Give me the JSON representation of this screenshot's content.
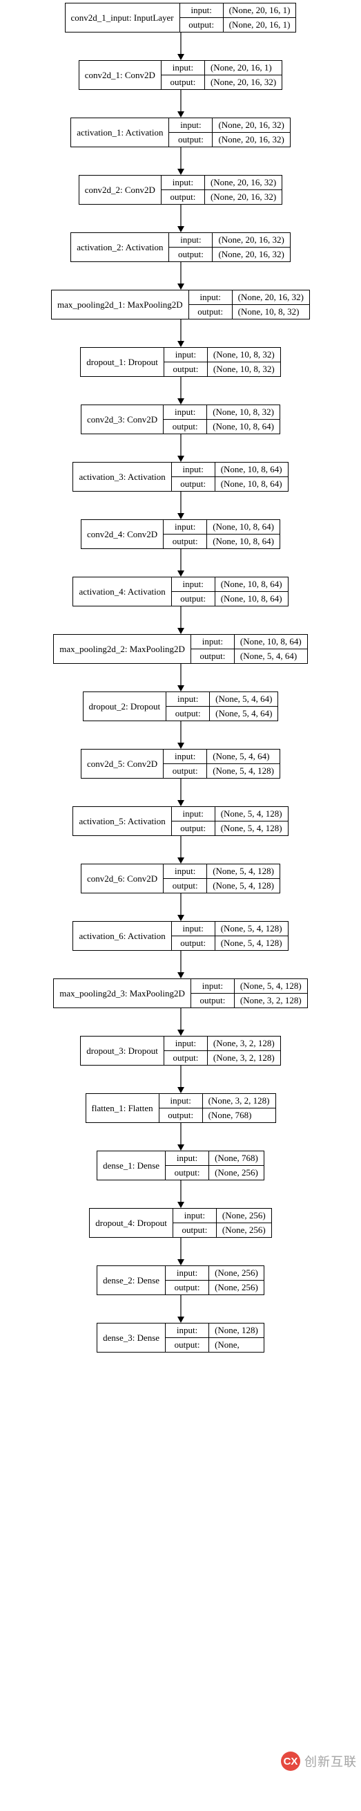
{
  "labels": {
    "input": "input:",
    "output": "output:"
  },
  "watermark": {
    "initials": "CX",
    "text": "创新互联"
  },
  "chart_data": {
    "type": "diagram",
    "title": "Keras Sequential CNN model graph",
    "nodes": [
      {
        "name": "conv2d_1_input: InputLayer",
        "in": "(None, 20, 16, 1)",
        "out": "(None, 20, 16, 1)"
      },
      {
        "name": "conv2d_1: Conv2D",
        "in": "(None, 20, 16, 1)",
        "out": "(None, 20, 16, 32)"
      },
      {
        "name": "activation_1: Activation",
        "in": "(None, 20, 16, 32)",
        "out": "(None, 20, 16, 32)"
      },
      {
        "name": "conv2d_2: Conv2D",
        "in": "(None, 20, 16, 32)",
        "out": "(None, 20, 16, 32)"
      },
      {
        "name": "activation_2: Activation",
        "in": "(None, 20, 16, 32)",
        "out": "(None, 20, 16, 32)"
      },
      {
        "name": "max_pooling2d_1: MaxPooling2D",
        "in": "(None, 20, 16, 32)",
        "out": "(None, 10, 8, 32)"
      },
      {
        "name": "dropout_1: Dropout",
        "in": "(None, 10, 8, 32)",
        "out": "(None, 10, 8, 32)"
      },
      {
        "name": "conv2d_3: Conv2D",
        "in": "(None, 10, 8, 32)",
        "out": "(None, 10, 8, 64)"
      },
      {
        "name": "activation_3: Activation",
        "in": "(None, 10, 8, 64)",
        "out": "(None, 10, 8, 64)"
      },
      {
        "name": "conv2d_4: Conv2D",
        "in": "(None, 10, 8, 64)",
        "out": "(None, 10, 8, 64)"
      },
      {
        "name": "activation_4: Activation",
        "in": "(None, 10, 8, 64)",
        "out": "(None, 10, 8, 64)"
      },
      {
        "name": "max_pooling2d_2: MaxPooling2D",
        "in": "(None, 10, 8, 64)",
        "out": "(None, 5, 4, 64)"
      },
      {
        "name": "dropout_2: Dropout",
        "in": "(None, 5, 4, 64)",
        "out": "(None, 5, 4, 64)"
      },
      {
        "name": "conv2d_5: Conv2D",
        "in": "(None, 5, 4, 64)",
        "out": "(None, 5, 4, 128)"
      },
      {
        "name": "activation_5: Activation",
        "in": "(None, 5, 4, 128)",
        "out": "(None, 5, 4, 128)"
      },
      {
        "name": "conv2d_6: Conv2D",
        "in": "(None, 5, 4, 128)",
        "out": "(None, 5, 4, 128)"
      },
      {
        "name": "activation_6: Activation",
        "in": "(None, 5, 4, 128)",
        "out": "(None, 5, 4, 128)"
      },
      {
        "name": "max_pooling2d_3: MaxPooling2D",
        "in": "(None, 5, 4, 128)",
        "out": "(None, 3, 2, 128)"
      },
      {
        "name": "dropout_3: Dropout",
        "in": "(None, 3, 2, 128)",
        "out": "(None, 3, 2, 128)"
      },
      {
        "name": "flatten_1: Flatten",
        "in": "(None, 3, 2, 128)",
        "out": "(None, 768)"
      },
      {
        "name": "dense_1: Dense",
        "in": "(None, 768)",
        "out": "(None, 256)"
      },
      {
        "name": "dropout_4: Dropout",
        "in": "(None, 256)",
        "out": "(None, 256)"
      },
      {
        "name": "dense_2: Dense",
        "in": "(None, 256)",
        "out": "(None, 256)"
      },
      {
        "name": "dense_3: Dense",
        "in": "(None, 128)",
        "out": "(None, "
      }
    ]
  }
}
